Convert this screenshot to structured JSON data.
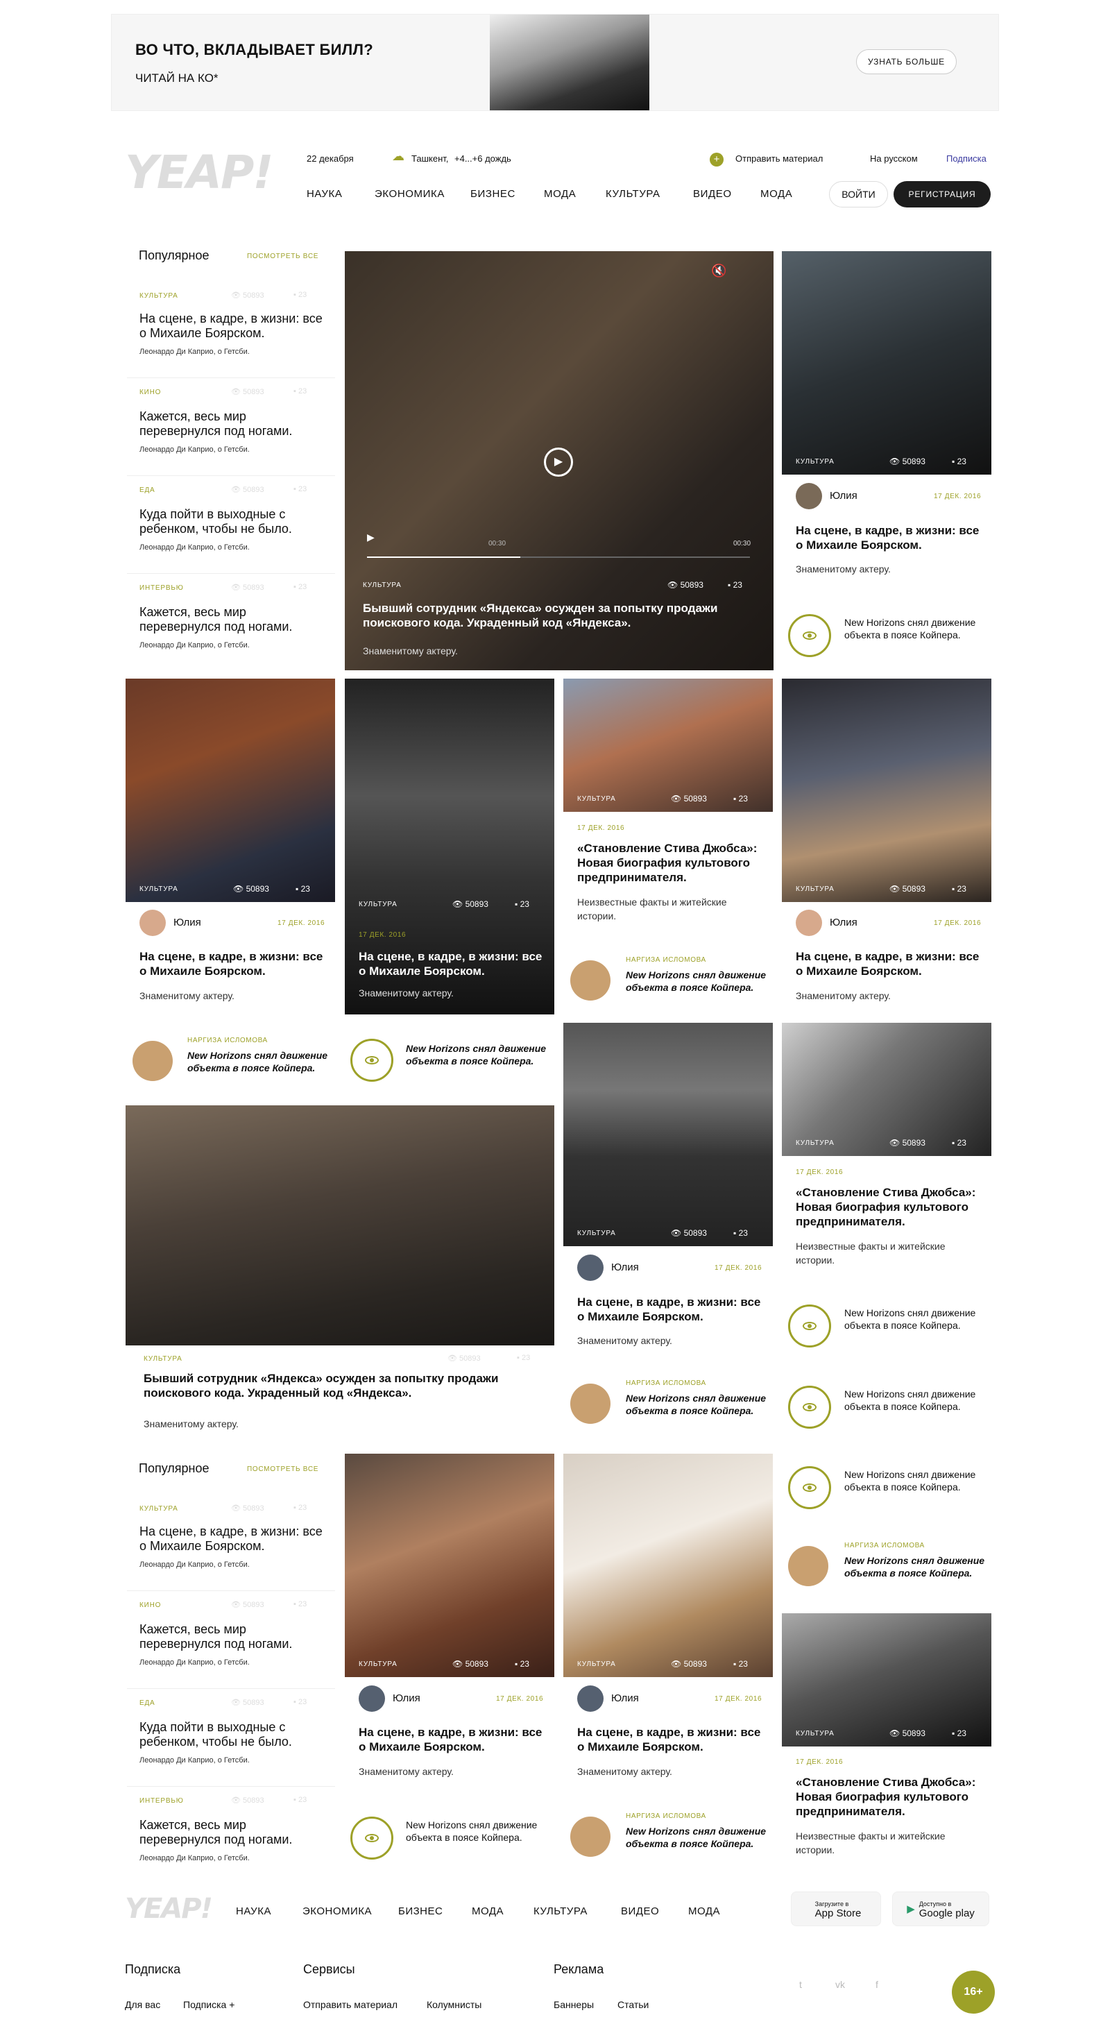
{
  "banner": {
    "title": "ВО ЧТО, ВКЛАДЫВАЕТ БИЛЛ?",
    "subtitle": "ЧИТАЙ НА КО*",
    "button": "УЗНАТЬ БОЛЬШЕ"
  },
  "header": {
    "logo": "YEAP!",
    "date": "22 декабря",
    "city": "Ташкент,",
    "weather": "+4...+6 дождь",
    "send": "Отправить материал",
    "lang": "На русском",
    "subscribe": "Подписка",
    "login": "ВОЙТИ",
    "register": "РЕГИСТРАЦИЯ",
    "nav": [
      "НАУКА",
      "ЭКОНОМИКА",
      "БИЗНЕС",
      "МОДА",
      "КУЛЬТУРА",
      "ВИДЕО",
      "МОДА"
    ]
  },
  "popular": {
    "title": "Популярное",
    "all": "ПОСМОТРЕТЬ ВСЕ",
    "items": [
      {
        "cat": "КУЛЬТУРА",
        "views": "50893",
        "comments": "23",
        "title": "На сцене, в кадре, в жизни: все о Михаиле Боярском.",
        "author": "Леонардо Ди Каприо, о Гетсби."
      },
      {
        "cat": "КИНО",
        "views": "50893",
        "comments": "23",
        "title": "Кажется, весь мир перевернулся под ногами.",
        "author": "Леонардо Ди Каприо, о Гетсби."
      },
      {
        "cat": "ЕДА",
        "views": "50893",
        "comments": "23",
        "title": "Куда пойти в выходные с ребенком, чтобы не было.",
        "author": "Леонардо Ди Каприо, о Гетсби."
      },
      {
        "cat": "ИНТЕРВЬЮ",
        "views": "50893",
        "comments": "23",
        "title": "Кажется, весь мир перевернулся под ногами.",
        "author": "Леонардо Ди Каприо, о Гетсби."
      }
    ]
  },
  "video": {
    "cat": "КУЛЬТУРА",
    "views": "50893",
    "comments": "23",
    "title": "Бывший сотрудник «Яндекса» осужден за попытку продажи поискового кода. Украденный код «Яндекса».",
    "sub": "Знаменитому актеру.",
    "time_cur": "00:30",
    "time_total": "00:30"
  },
  "cards": {
    "cat": "КУЛЬТУРА",
    "views": "50893",
    "comments": "23",
    "date": "17 ДЕК. 2016",
    "author": "Юлия",
    "title_a": "На сцене, в кадре, в жизни: все о Михаиле Боярском.",
    "sub_a": "Знаменитому актеру.",
    "title_b": "«Становление Стива Джобса»: Новая биография культового предпринимателя.",
    "sub_b": "Неизвестные факты и житейские истории.",
    "nh": "New Horizons снял движение объекта в поясе Койпера.",
    "narg": "НАРГИЗА ИСЛОМОВА",
    "big_title": "Бывший сотрудник «Яндекса» осужден за попытку продажи поискового кода. Украденный код «Яндекса».",
    "big_sub": "Знаменитому актеру."
  },
  "footer": {
    "logo": "YEAP!",
    "nav": [
      "НАУКА",
      "ЭКОНОМИКА",
      "БИЗНЕС",
      "МОДА",
      "КУЛЬТУРА",
      "ВИДЕО",
      "МОДА"
    ],
    "appstore": "App Store",
    "appstore_small": "Загрузите в",
    "gplay": "Google play",
    "gplay_small": "Доступно в",
    "subscribe": "Подписка",
    "sub_links": [
      "Для вас",
      "Подписка +"
    ],
    "services": "Сервисы",
    "serv_links": [
      "Отправить материал",
      "Колумнисты"
    ],
    "ads": "Реклама",
    "ads_links": [
      "Баннеры",
      "Статьи"
    ],
    "age": "16+",
    "social": [
      "t",
      "vk",
      "f"
    ]
  }
}
